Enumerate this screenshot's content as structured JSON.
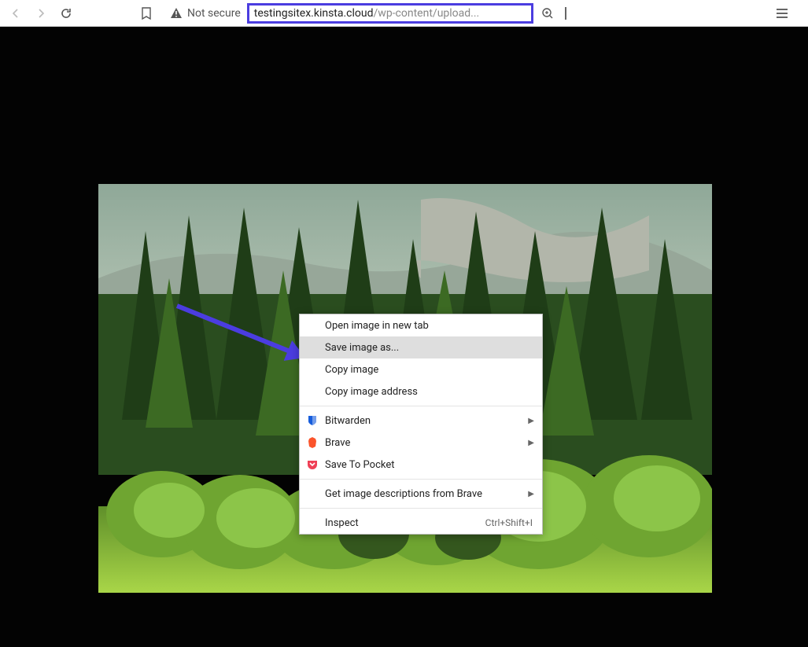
{
  "toolbar": {
    "not_secure_label": "Not secure",
    "url_main": "testingsitex.kinsta.cloud",
    "url_path": "/wp-content/upload..."
  },
  "context_menu": {
    "items": [
      {
        "label": "Open image in new tab",
        "highlighted": false
      },
      {
        "label": "Save image as...",
        "highlighted": true
      },
      {
        "label": "Copy image",
        "highlighted": false
      },
      {
        "label": "Copy image address",
        "highlighted": false
      }
    ],
    "extension_items": [
      {
        "label": "Bitwarden",
        "icon": "bitwarden",
        "submenu": true
      },
      {
        "label": "Brave",
        "icon": "brave",
        "submenu": true
      },
      {
        "label": "Save To Pocket",
        "icon": "pocket",
        "submenu": false
      }
    ],
    "more_items": [
      {
        "label": "Get image descriptions from Brave",
        "submenu": true
      }
    ],
    "inspect": {
      "label": "Inspect",
      "shortcut": "Ctrl+Shift+I"
    }
  },
  "annotation": {
    "highlight_color": "#4b3de0"
  }
}
